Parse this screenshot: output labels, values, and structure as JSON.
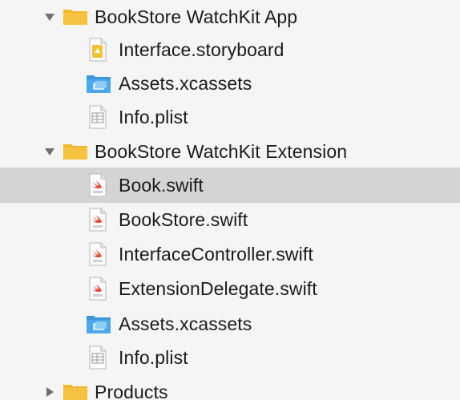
{
  "navigator": {
    "colors": {
      "folder": "#f6c23f",
      "folder_tab": "#f2b62c",
      "assets": "#4aa8ec",
      "swift": "#e8462e",
      "selected_row": "#d4d4d4"
    },
    "items": [
      {
        "label": "BookStore WatchKit App",
        "kind": "folder",
        "expanded": true,
        "icon": "folder-icon"
      },
      {
        "label": "Interface.storyboard",
        "kind": "storyboard",
        "icon": "storyboard-file-icon"
      },
      {
        "label": "Assets.xcassets",
        "kind": "assets",
        "icon": "asset-catalog-icon"
      },
      {
        "label": "Info.plist",
        "kind": "plist",
        "icon": "plist-file-icon"
      },
      {
        "label": "BookStore WatchKit Extension",
        "kind": "folder",
        "expanded": true,
        "icon": "folder-icon"
      },
      {
        "label": "Book.swift",
        "kind": "swift",
        "selected": true,
        "icon": "swift-file-icon"
      },
      {
        "label": "BookStore.swift",
        "kind": "swift",
        "icon": "swift-file-icon"
      },
      {
        "label": "InterfaceController.swift",
        "kind": "swift",
        "icon": "swift-file-icon"
      },
      {
        "label": "ExtensionDelegate.swift",
        "kind": "swift",
        "icon": "swift-file-icon"
      },
      {
        "label": "Assets.xcassets",
        "kind": "assets",
        "icon": "asset-catalog-icon"
      },
      {
        "label": "Info.plist",
        "kind": "plist",
        "icon": "plist-file-icon"
      },
      {
        "label": "Products",
        "kind": "folder",
        "expanded": false,
        "icon": "folder-icon"
      }
    ]
  }
}
